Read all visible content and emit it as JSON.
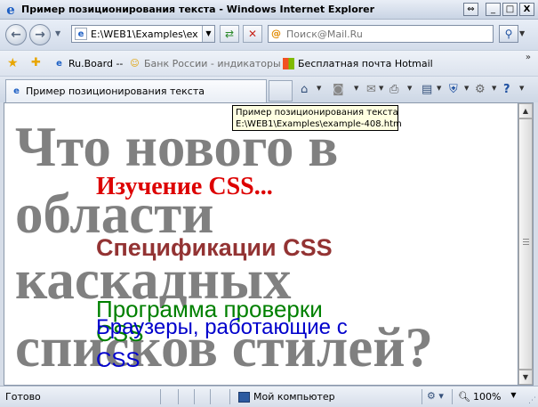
{
  "window": {
    "title": "Пример позиционирования текста - Windows Internet Explorer",
    "buttons": {
      "help": "⇔",
      "minimize": "_",
      "maximize": "□",
      "close": "X"
    }
  },
  "navigation": {
    "back_icon": "back-arrow-icon",
    "forward_icon": "forward-arrow-icon",
    "address": "E:\\WEB1\\Examples\\example-408.htm",
    "search_placeholder": "Поиск@Mail.Ru"
  },
  "favorites": {
    "items": [
      {
        "label": "Ru.Board --",
        "icon": "page-icon"
      },
      {
        "label": "Банк России - индикаторы",
        "icon": "smiley-icon"
      },
      {
        "label": "Бесплатная почта Hotmail",
        "icon": "windows-logo-icon"
      }
    ]
  },
  "tab": {
    "label": "Пример позиционирования текста"
  },
  "tooltip": {
    "line1": "Пример позиционирования текста",
    "line2": "E:\\WEB1\\Examples\\example-408.htm"
  },
  "content": {
    "big_text_line1": "Что нового в",
    "big_text_line2": "области",
    "big_text_line3": "каскадных",
    "big_text_line4": "списков стилей?",
    "red_heading": "Изучение CSS...",
    "brown_heading": "Спецификации CSS",
    "green_line1": "Программа проверки",
    "green_line2": "CSS",
    "blue_line1": "Браузеры, работающие с",
    "blue_line2": "CSS",
    "colors": {
      "gray": "#808080",
      "red": "#dd0000",
      "brown": "#933333",
      "green": "#008000",
      "blue": "#0000cc"
    }
  },
  "status": {
    "text": "Готово",
    "zone": "Мой компьютер",
    "zoom": "100%"
  }
}
